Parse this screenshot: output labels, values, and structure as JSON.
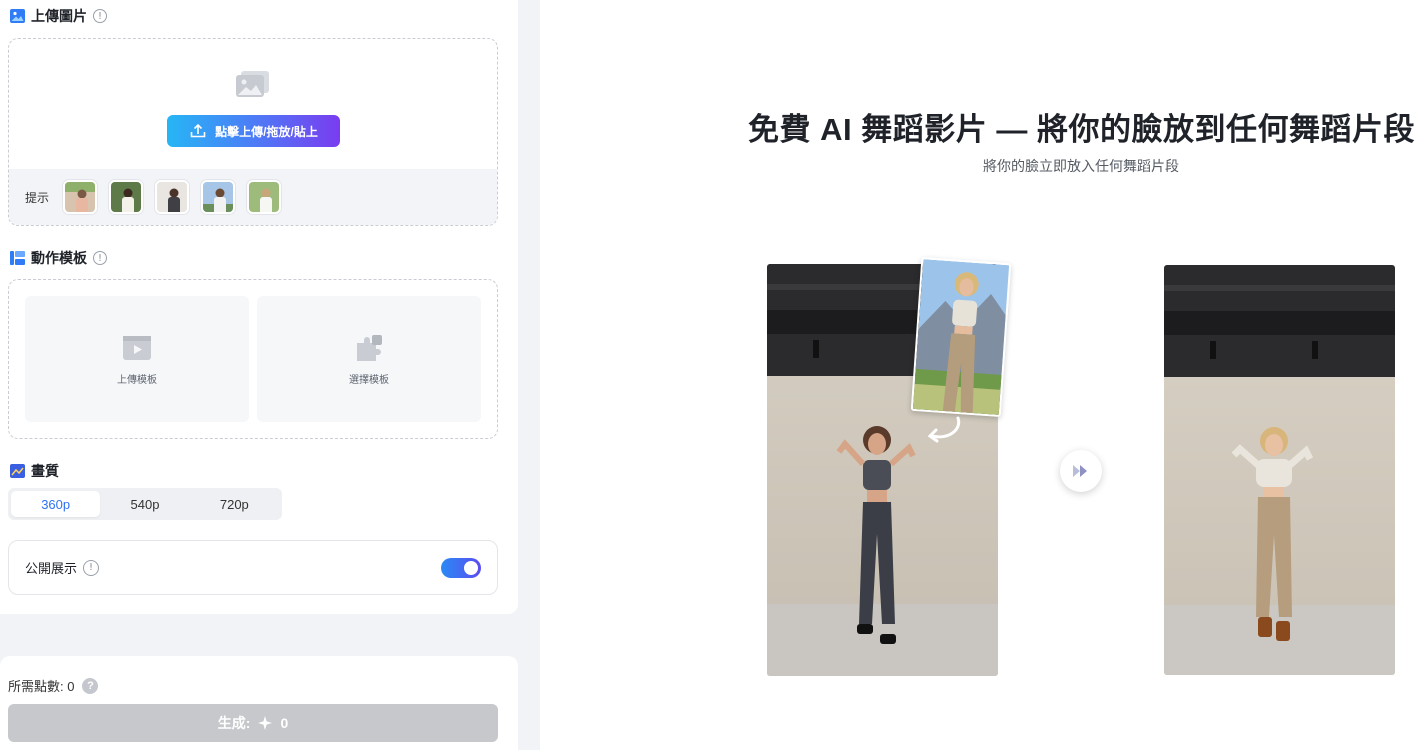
{
  "upload_section": {
    "title": "上傳圖片",
    "upload_button": "點擊上傳/拖放/貼上",
    "hint_label": "提示",
    "hint_thumbnails": [
      {
        "name": "sample-photo-1"
      },
      {
        "name": "sample-photo-2"
      },
      {
        "name": "sample-photo-3"
      },
      {
        "name": "sample-photo-4"
      },
      {
        "name": "sample-photo-5"
      }
    ]
  },
  "template_section": {
    "title": "動作模板",
    "upload_template": "上傳模板",
    "select_template": "選擇模板"
  },
  "quality_section": {
    "title": "畫質",
    "options": [
      "360p",
      "540p",
      "720p"
    ],
    "selected": "360p"
  },
  "public_display": {
    "label": "公開展示",
    "enabled": true
  },
  "footer": {
    "points_label": "所需點數: 0",
    "generate_label": "生成:",
    "generate_cost": "0"
  },
  "hero": {
    "title": "免費 AI 舞蹈影片 — 將你的臉放到任何舞蹈片段",
    "subtitle": "將你的臉立即放入任何舞蹈片段"
  },
  "colors": {
    "accent": "#2f73f0",
    "upload_gradient_start": "#26b6f5",
    "upload_gradient_end": "#7a3cf0",
    "generate_disabled": "#c6c8cc"
  }
}
